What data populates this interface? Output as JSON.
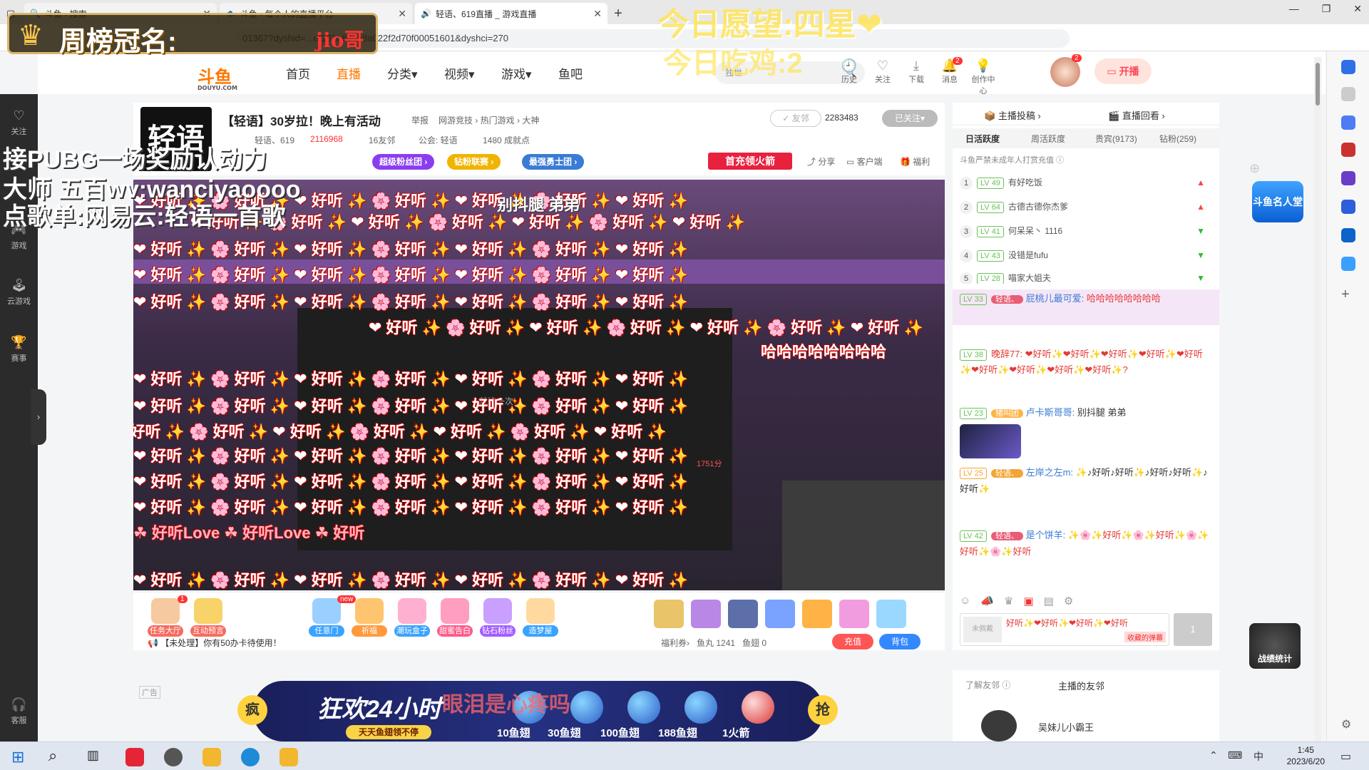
{
  "browser": {
    "tabs": [
      {
        "title": "斗鱼 - 搜索",
        "active": false
      },
      {
        "title": "斗鱼 - 每个人的直播平台",
        "active": false
      },
      {
        "title": "轻语、619直播 _ 游戏直播",
        "active": true
      }
    ],
    "new_tab": "+",
    "url": "01367?dyshid=...ef181a684b8a022f2d70f00051601&dyshci=270",
    "window_controls": [
      "—",
      "❐",
      "✕"
    ]
  },
  "site": {
    "logo": "斗鱼",
    "logo_sub": "DOUYU.COM",
    "nav": [
      "首页",
      "直播",
      "分类",
      "视频",
      "游戏",
      "鱼吧"
    ],
    "search_placeholder": "独世",
    "header_icons": [
      {
        "name": "history",
        "label": "历史"
      },
      {
        "name": "follow",
        "label": "关注"
      },
      {
        "name": "download",
        "label": "下载"
      },
      {
        "name": "message",
        "label": "消息",
        "badge": "2"
      },
      {
        "name": "creator",
        "label": "创作中心"
      }
    ],
    "avatar_badge": "2",
    "golive": "开播"
  },
  "leftnav": [
    {
      "icon": "heart-icon",
      "label": "关注"
    },
    {
      "icon": "gamepad-icon",
      "label": "游戏"
    },
    {
      "icon": "cloud-game-icon",
      "label": "云游戏"
    },
    {
      "icon": "trophy-icon",
      "label": "赛事"
    },
    {
      "icon": "headset-icon",
      "label": "客服"
    }
  ],
  "room": {
    "logo_text": "轻语",
    "title": "【轻语】30岁拉！晚上有活动",
    "report": "举报",
    "breadcrumb": "网游竞技 › 热门游戏 › 大神",
    "host": "轻语、619",
    "hot": "2116968",
    "friends": "16友邻",
    "guild": "公会: 轻语",
    "achievements": "1480 成就点",
    "unfollow": "✓ 友邻",
    "follow_count": "2283483",
    "followed": "已关注",
    "pills": [
      "超级粉丝团 ›",
      "钻粉联赛 ›",
      "最强勇士团 ›"
    ],
    "recharge_activity": "首充领火箭",
    "actions": [
      "分享",
      "客户端",
      "福利"
    ]
  },
  "video": {
    "screen_caption": "就这一次",
    "screen_score": "1751分",
    "danmu_text": "❤ 好听 ✨ 🌸 好听 ✨ ❤ 好听 ✨ 🌸 好听 ✨ ❤ 好听 ✨ 🌸 好听 ✨ ❤ 好听 ✨",
    "danmu_laugh": "哈哈哈哈哈哈哈哈",
    "danmu_love": "☘ 好听Love ☘ 好听Love ☘ 好听",
    "danmu_name": "别抖腿 弟弟"
  },
  "gifts": [
    {
      "label": "任务大厅",
      "color": "#f76c5e",
      "badge": "1"
    },
    {
      "label": "互动预言",
      "color": "#f76c5e"
    },
    {
      "label": "任意门",
      "color": "#3aa3ff",
      "badge": "new"
    },
    {
      "label": "祈福",
      "color": "#ff9a3c"
    },
    {
      "label": "潮玩盒子",
      "color": "#3aa3ff"
    },
    {
      "label": "甜蜜告白",
      "color": "#ff5c8a"
    },
    {
      "label": "钻石粉丝",
      "color": "#a35cff"
    },
    {
      "label": "造梦屋",
      "color": "#3aa3ff"
    }
  ],
  "gift_icons_count_label": "",
  "giftbar": {
    "ticket_note": "【未处理】你有50办卡待使用！",
    "welfare": "福利券›",
    "fishball": "鱼丸 1241",
    "fishfin": "鱼翅 0",
    "recharge": "充值",
    "bag": "背包"
  },
  "banner": {
    "title": "狂欢24小时",
    "subtitle": "天天鱼翅领不停",
    "left_tag": "疯",
    "right_tag": "抢",
    "items": [
      "10鱼翅",
      "30鱼翅",
      "100鱼翅",
      "188鱼翅",
      "1火箭"
    ],
    "overlay_text": "眼泪是心疼吗"
  },
  "ad_tag": "广告",
  "rpanel": {
    "top_links": [
      "主播投稿 ›",
      "直播回看 ›"
    ],
    "tabs": [
      "日活跃度",
      "周活跃度",
      "贵宾(9173)",
      "钻粉(259)"
    ],
    "notice": "斗鱼严禁未成年人打赏充值",
    "ranking": [
      {
        "no": "1",
        "lv": "LV 49",
        "name": "有好吃饭",
        "trend": "up"
      },
      {
        "no": "2",
        "lv": "LV 64",
        "name": "古德古德你杰爹",
        "trend": "up"
      },
      {
        "no": "3",
        "lv": "LV 41",
        "name": "何呆呆丶 1116",
        "trend": "down"
      },
      {
        "no": "4",
        "lv": "LV 43",
        "name": "没错是fufu",
        "trend": "down"
      },
      {
        "no": "5",
        "lv": "LV 28",
        "name": "喵家大姐夫",
        "trend": "down"
      }
    ],
    "chats": [
      {
        "lv": "LV 33",
        "badge": "轻语、",
        "who": "屁桃儿最可爱:",
        "text": "哈哈哈哈哈哈哈哈"
      },
      {
        "lv": "LV 38",
        "badge": "",
        "who": "晚辞77:",
        "text": "❤好听✨❤好听✨❤好听✨❤好听✨❤好听✨❤好听✨❤好听✨❤好听✨❤好听✨?"
      },
      {
        "lv": "LV 23",
        "badge": "猪叫团",
        "who": "卢卡斯哥哥:",
        "text": "别抖腿 弟弟"
      },
      {
        "lv": "LV 25",
        "badge": "轻语、",
        "who": "左岸之左m:",
        "text": "✨♪好听♪好听✨♪好听♪好听✨♪好听✨"
      },
      {
        "lv": "LV 42",
        "badge": "轻语、",
        "who": "是个饼羊:",
        "text": "✨🌸✨好听✨🌸✨好听✨🌸✨好听✨🌸✨好听"
      }
    ],
    "input_preview": "好听✨❤好听✨❤好听✨❤好听",
    "input_tag": "收藏的弹幕",
    "send": "1",
    "unmute": "未佩戴",
    "bottom_tabs": [
      "了解友邻 ⓘ",
      "主播的友邻"
    ],
    "friend_name": "吴妹儿小霸王"
  },
  "overlays": {
    "crown": "周榜冠名:",
    "crown_name": "jio哥",
    "wish": "今日愿望:四星❤",
    "eat": "今日吃鸡:2",
    "line1": "接PUBG一场奖励认动力",
    "line2": "大师 五百wv:wanciyaoooo",
    "line3": "点歌单:网易云:轻语一首歌",
    "fame": "斗鱼名人堂",
    "stats": "战绩统计"
  },
  "taskbar": {
    "time": "1:45",
    "date": "2023/6/20",
    "ime": "中"
  }
}
